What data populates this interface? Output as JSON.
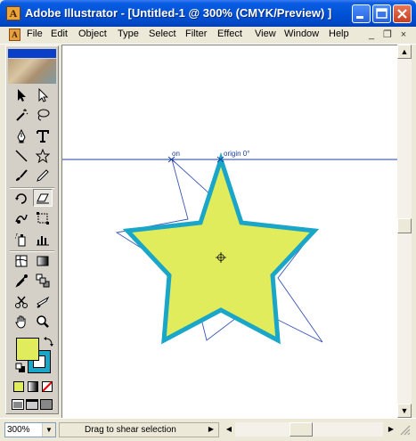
{
  "window": {
    "title": "Adobe Illustrator - [Untitled-1 @ 300% (CMYK/Preview) ]",
    "minimize_icon": "minimize-icon",
    "maximize_icon": "maximize-icon",
    "close_icon": "close-icon"
  },
  "menubar": {
    "items": [
      "File",
      "Edit",
      "Object",
      "Type",
      "Select",
      "Filter",
      "Effect",
      "View",
      "Window",
      "Help"
    ],
    "doc_controls": [
      "_",
      "❐",
      "×"
    ]
  },
  "toolbox": {
    "tools": [
      "selection-tool",
      "direct-selection-tool",
      "magic-wand-tool",
      "lasso-tool",
      "pen-tool",
      "type-tool",
      "line-segment-tool",
      "star-tool",
      "paintbrush-tool",
      "pencil-tool",
      "rotate-tool",
      "shear-tool",
      "warp-tool",
      "free-transform-tool",
      "symbol-sprayer-tool",
      "column-graph-tool",
      "mesh-tool",
      "gradient-tool",
      "eyedropper-tool",
      "blend-tool",
      "scissors-tool",
      "knife-tool",
      "hand-tool",
      "zoom-tool"
    ],
    "active_tool": "shear-tool",
    "fill_color": "#E0EC5C",
    "stroke_color": "#1AA6C8"
  },
  "canvas": {
    "smart_guide_label_left": "on",
    "smart_guide_label_right": "origin 0°",
    "star_fill": "#E0EC5C",
    "star_stroke": "#1AA6C8",
    "guide_color": "#1A3F9E"
  },
  "statusbar": {
    "zoom": "300%",
    "status_text": "Drag to shear selection"
  }
}
